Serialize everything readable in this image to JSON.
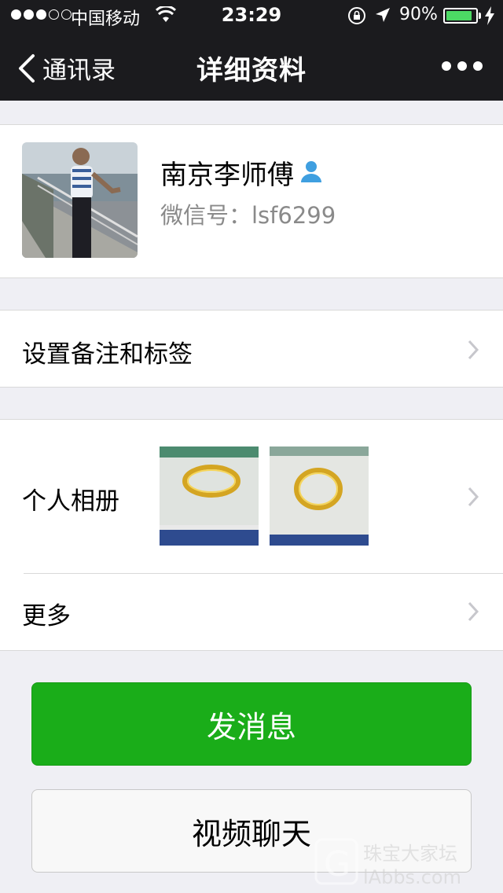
{
  "status_bar": {
    "carrier": "中国移动",
    "time": "23:29",
    "battery": "90%",
    "battery_level": 0.9,
    "icons": [
      "signal-icon",
      "wifi-icon",
      "rotation-lock-icon",
      "location-icon",
      "battery-icon",
      "charging-bolt-icon"
    ]
  },
  "nav": {
    "back_label": "通讯录",
    "title": "详细资料",
    "more_icon": "more-dots-icon"
  },
  "profile": {
    "name": "南京李师傅",
    "wechat_id": "微信号：lsf6299",
    "badge_icon": "contact-person-icon"
  },
  "rows": {
    "remark": "设置备注和标签",
    "album": "个人相册",
    "more": "更多"
  },
  "buttons": {
    "send_message": "发消息",
    "video_chat": "视频聊天"
  },
  "watermark": {
    "text_cn": "珠宝大家坛",
    "text_en": "lAbbs.com"
  },
  "colors": {
    "nav_bg": "#1b1b1e",
    "primary_green": "#1aad19",
    "page_bg": "#efeff4"
  }
}
